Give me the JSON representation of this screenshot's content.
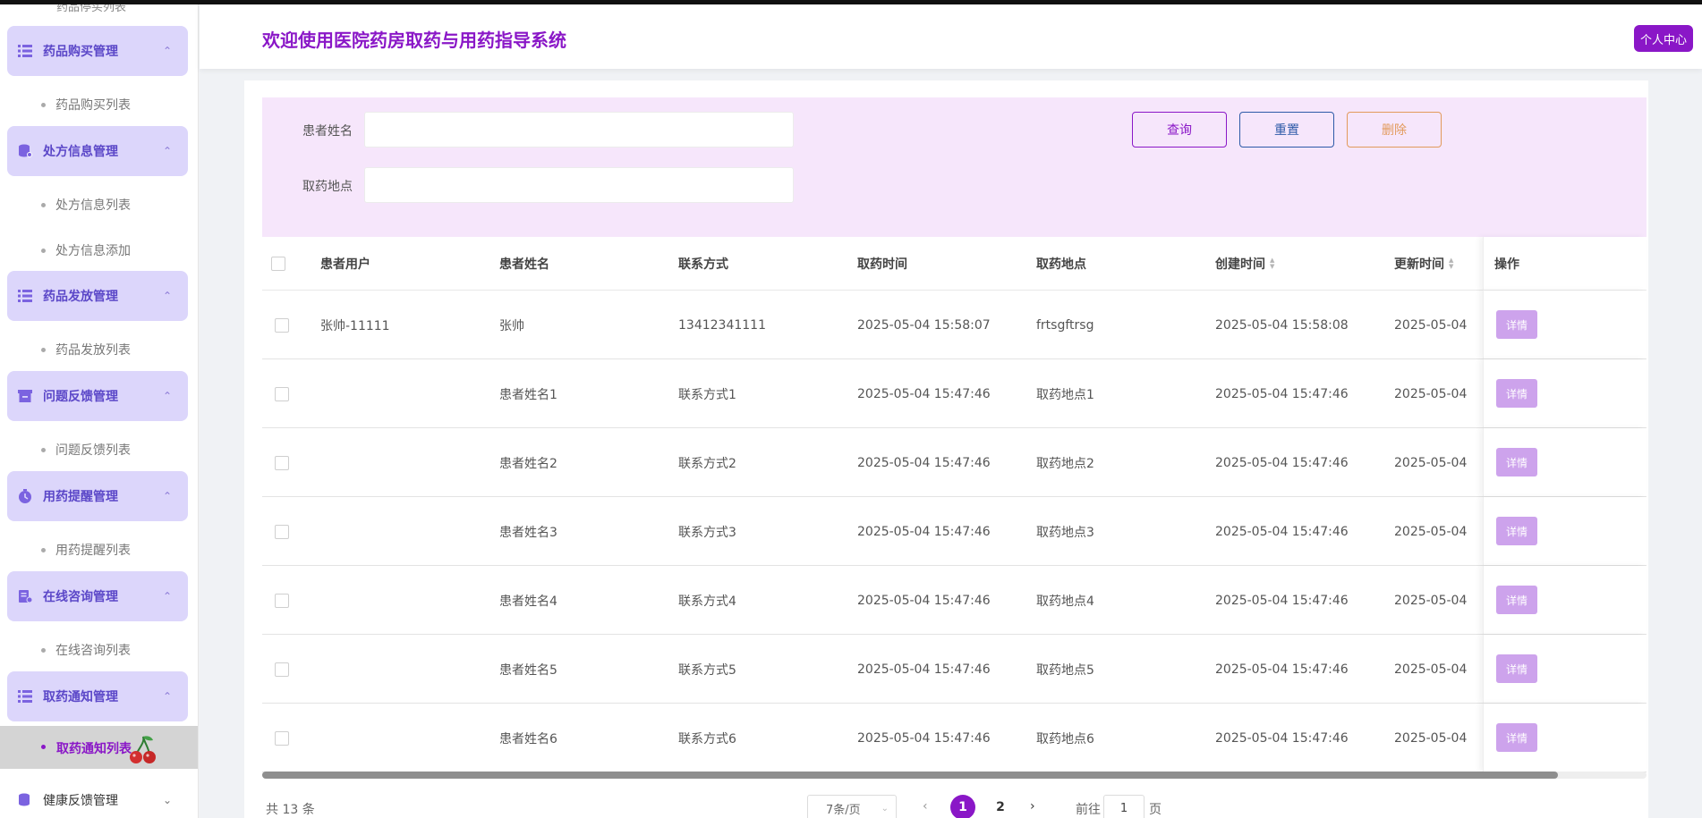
{
  "colors": {
    "primary": "#8a17c7",
    "menu_bg": "#dcd6fb",
    "filter_bg": "#f6e6fb",
    "detail_btn": "#cda3ec"
  },
  "sidebar": {
    "cutoff_label": "药品停买列表",
    "groups": [
      {
        "label": "药品购买管理",
        "icon": "list-icon",
        "sub": [
          "药品购买列表"
        ]
      },
      {
        "label": "处方信息管理",
        "icon": "database-icon",
        "sub": [
          "处方信息列表",
          "处方信息添加"
        ]
      },
      {
        "label": "药品发放管理",
        "icon": "list-icon",
        "sub": [
          "药品发放列表"
        ]
      },
      {
        "label": "问题反馈管理",
        "icon": "archive-icon",
        "sub": [
          "问题反馈列表"
        ]
      },
      {
        "label": "用药提醒管理",
        "icon": "clock-icon",
        "sub": [
          "用药提醒列表"
        ]
      },
      {
        "label": "在线咨询管理",
        "icon": "edit-doc-icon",
        "sub": [
          "在线咨询列表"
        ]
      },
      {
        "label": "取药通知管理",
        "icon": "list-icon",
        "sub": [
          "取药通知列表"
        ]
      }
    ],
    "active_item": "取药通知列表",
    "collapsed_group": "健康反馈管理",
    "chevron_up": "⌃",
    "chevron_down": "⌄"
  },
  "header": {
    "title": "欢迎使用医院药房取药与用药指导系统",
    "profile_button": "个人中心"
  },
  "filter": {
    "patient_name_label": "患者姓名",
    "pickup_location_label": "取药地点",
    "patient_name_value": "",
    "pickup_location_value": "",
    "search_button": "查询",
    "reset_button": "重置",
    "delete_button": "删除"
  },
  "table": {
    "columns": [
      "患者用户",
      "患者姓名",
      "联系方式",
      "取药时间",
      "取药地点",
      "创建时间",
      "更新时间",
      "操作"
    ],
    "detail_label": "详情",
    "rows": [
      {
        "user": "张帅-11111",
        "name": "张帅",
        "contact": "13412341111",
        "pickup_time": "2025-05-04 15:58:07",
        "location": "frtsgftrsg",
        "created": "2025-05-04 15:58:08",
        "updated": "2025-05-04"
      },
      {
        "user": "",
        "name": "患者姓名1",
        "contact": "联系方式1",
        "pickup_time": "2025-05-04 15:47:46",
        "location": "取药地点1",
        "created": "2025-05-04 15:47:46",
        "updated": "2025-05-04"
      },
      {
        "user": "",
        "name": "患者姓名2",
        "contact": "联系方式2",
        "pickup_time": "2025-05-04 15:47:46",
        "location": "取药地点2",
        "created": "2025-05-04 15:47:46",
        "updated": "2025-05-04"
      },
      {
        "user": "",
        "name": "患者姓名3",
        "contact": "联系方式3",
        "pickup_time": "2025-05-04 15:47:46",
        "location": "取药地点3",
        "created": "2025-05-04 15:47:46",
        "updated": "2025-05-04"
      },
      {
        "user": "",
        "name": "患者姓名4",
        "contact": "联系方式4",
        "pickup_time": "2025-05-04 15:47:46",
        "location": "取药地点4",
        "created": "2025-05-04 15:47:46",
        "updated": "2025-05-04"
      },
      {
        "user": "",
        "name": "患者姓名5",
        "contact": "联系方式5",
        "pickup_time": "2025-05-04 15:47:46",
        "location": "取药地点5",
        "created": "2025-05-04 15:47:46",
        "updated": "2025-05-04"
      },
      {
        "user": "",
        "name": "患者姓名6",
        "contact": "联系方式6",
        "pickup_time": "2025-05-04 15:47:46",
        "location": "取药地点6",
        "created": "2025-05-04 15:47:46",
        "updated": "2025-05-04"
      }
    ]
  },
  "pagination": {
    "total_text": "共 13 条",
    "page_size": "7条/页",
    "pages": [
      "1",
      "2"
    ],
    "current_page": "1",
    "goto_prefix": "前往",
    "goto_value": "1",
    "goto_suffix": "页",
    "prev_arrow": "‹",
    "next_arrow": "›"
  }
}
